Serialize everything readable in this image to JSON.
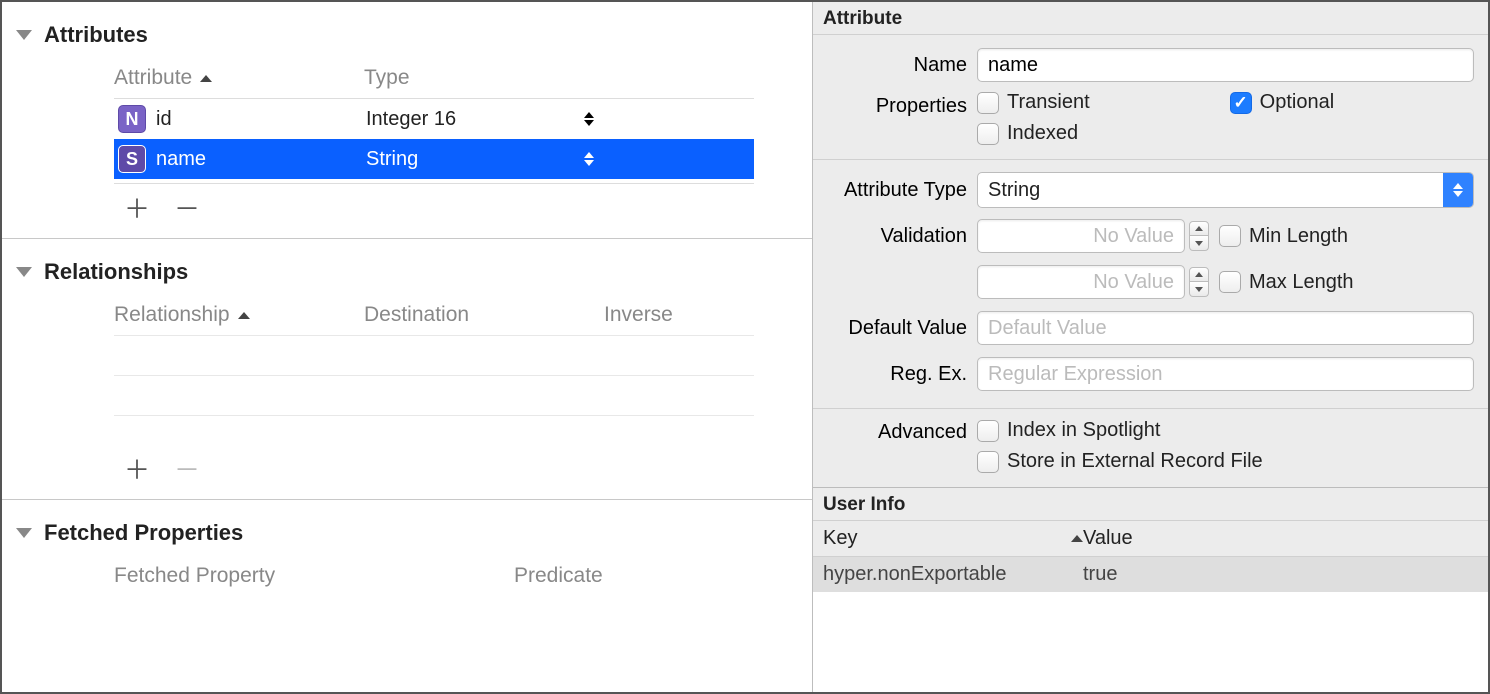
{
  "left": {
    "attributes": {
      "title": "Attributes",
      "columns": {
        "attr": "Attribute",
        "type": "Type"
      },
      "rows": [
        {
          "badge": "N",
          "name": "id",
          "type": "Integer 16",
          "selected": false
        },
        {
          "badge": "S",
          "name": "name",
          "type": "String",
          "selected": true
        }
      ]
    },
    "relationships": {
      "title": "Relationships",
      "columns": {
        "rel": "Relationship",
        "dest": "Destination",
        "inv": "Inverse"
      }
    },
    "fetched": {
      "title": "Fetched Properties",
      "columns": {
        "fp": "Fetched Property",
        "pred": "Predicate"
      }
    }
  },
  "right": {
    "title": "Attribute",
    "name_label": "Name",
    "name_value": "name",
    "properties_label": "Properties",
    "prop_transient": "Transient",
    "prop_optional": "Optional",
    "prop_indexed": "Indexed",
    "attr_type_label": "Attribute Type",
    "attr_type_value": "String",
    "validation_label": "Validation",
    "no_value_placeholder": "No Value",
    "min_length": "Min Length",
    "max_length": "Max Length",
    "default_label": "Default Value",
    "default_placeholder": "Default Value",
    "regex_label": "Reg. Ex.",
    "regex_placeholder": "Regular Expression",
    "advanced_label": "Advanced",
    "adv_spotlight": "Index in Spotlight",
    "adv_external": "Store in External Record File",
    "userinfo": {
      "title": "User Info",
      "key_header": "Key",
      "value_header": "Value",
      "rows": [
        {
          "key": "hyper.nonExportable",
          "value": "true"
        }
      ]
    }
  }
}
